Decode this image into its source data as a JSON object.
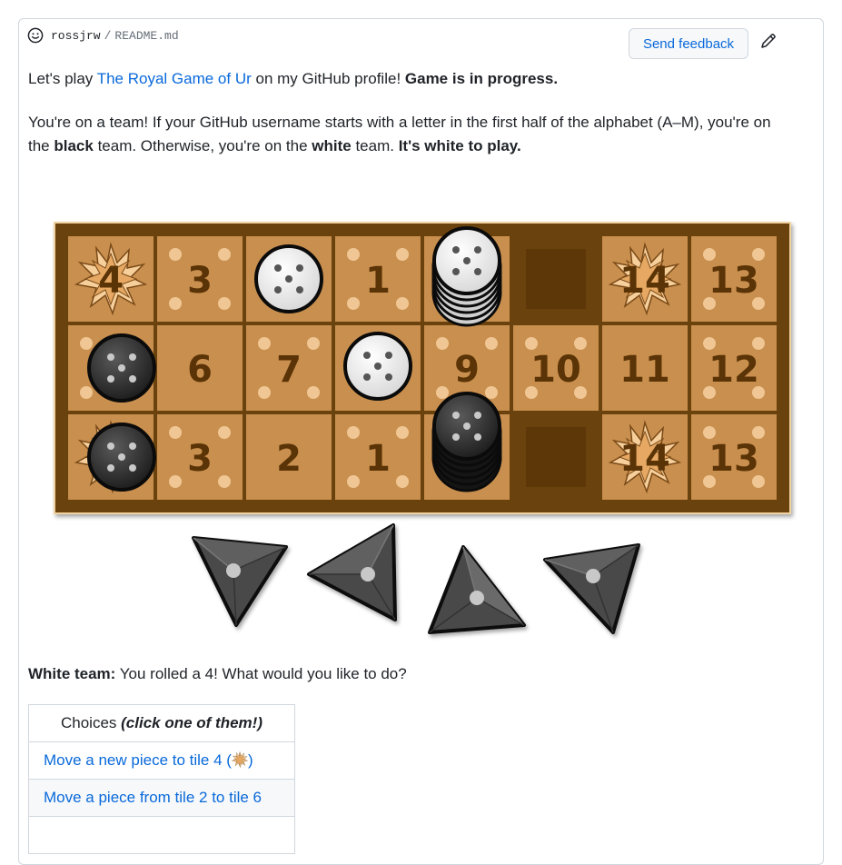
{
  "header": {
    "user": "rossjrw",
    "separator": "/",
    "file": "README.md",
    "feedback_label": "Send feedback"
  },
  "intro": {
    "prefix": "Let's play ",
    "link": "The Royal Game of Ur",
    "middle": " on my GitHub profile! ",
    "status": "Game is in progress."
  },
  "team": {
    "t1": "You're on a team! If your GitHub username starts with a letter in the first half of the alphabet (A–M), you're on the ",
    "black": "black",
    "t2": " team. Otherwise, you're on the ",
    "white": "white",
    "t3": " team. ",
    "turn": "It's white to play."
  },
  "board": {
    "rows": [
      [
        "4",
        "3",
        "",
        "1",
        "",
        "",
        "14",
        "13"
      ],
      [
        "",
        "6",
        "7",
        "",
        "9",
        "10",
        "11",
        "12"
      ],
      [
        "",
        "3",
        "2",
        "1",
        "",
        "",
        "14",
        "13"
      ]
    ],
    "colors": {
      "frame": "#6b4211",
      "tile": "#c98f4e",
      "dot": "#f0c794",
      "number": "#5a3306",
      "white_piece": "#ececec",
      "black_piece": "#2e2e2e"
    }
  },
  "dice": {
    "count": 4,
    "rolled": 4
  },
  "roll": {
    "team": "White team:",
    "message": " You rolled a 4! What would you like to do?"
  },
  "choices": {
    "header": "Choices ",
    "header_em": "(click one of them!)",
    "items": [
      {
        "pre": "Move a new piece to tile 4 (",
        "post": ")"
      },
      {
        "pre": "Move a piece from tile 2 to tile 6",
        "post": ""
      }
    ]
  }
}
